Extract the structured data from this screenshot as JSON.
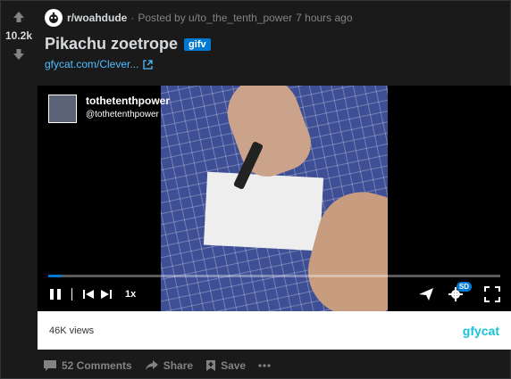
{
  "votes": {
    "score": "10.2k"
  },
  "post": {
    "subreddit": "r/woahdude",
    "posted_by": "Posted by u/to_the_tenth_power",
    "time": "7 hours ago",
    "title": "Pikachu zoetrope",
    "flair": "gifv",
    "link_text": "gfycat.com/Clever..."
  },
  "player": {
    "user_name": "tothetenthpower",
    "user_handle": "@tothetenthpower",
    "speed": "1x",
    "quality": "SD",
    "progress": 0.03
  },
  "footer": {
    "views": "46K views",
    "logo": "gfycat"
  },
  "actions": {
    "comments": "52 Comments",
    "share": "Share",
    "save": "Save"
  },
  "icons": [
    "upvote-icon",
    "downvote-icon",
    "external-link-icon",
    "play-icon",
    "previous-icon",
    "next-icon",
    "share-arrow-icon",
    "settings-icon",
    "fullscreen-icon",
    "comment-icon",
    "share-icon",
    "save-icon",
    "more-icon"
  ]
}
